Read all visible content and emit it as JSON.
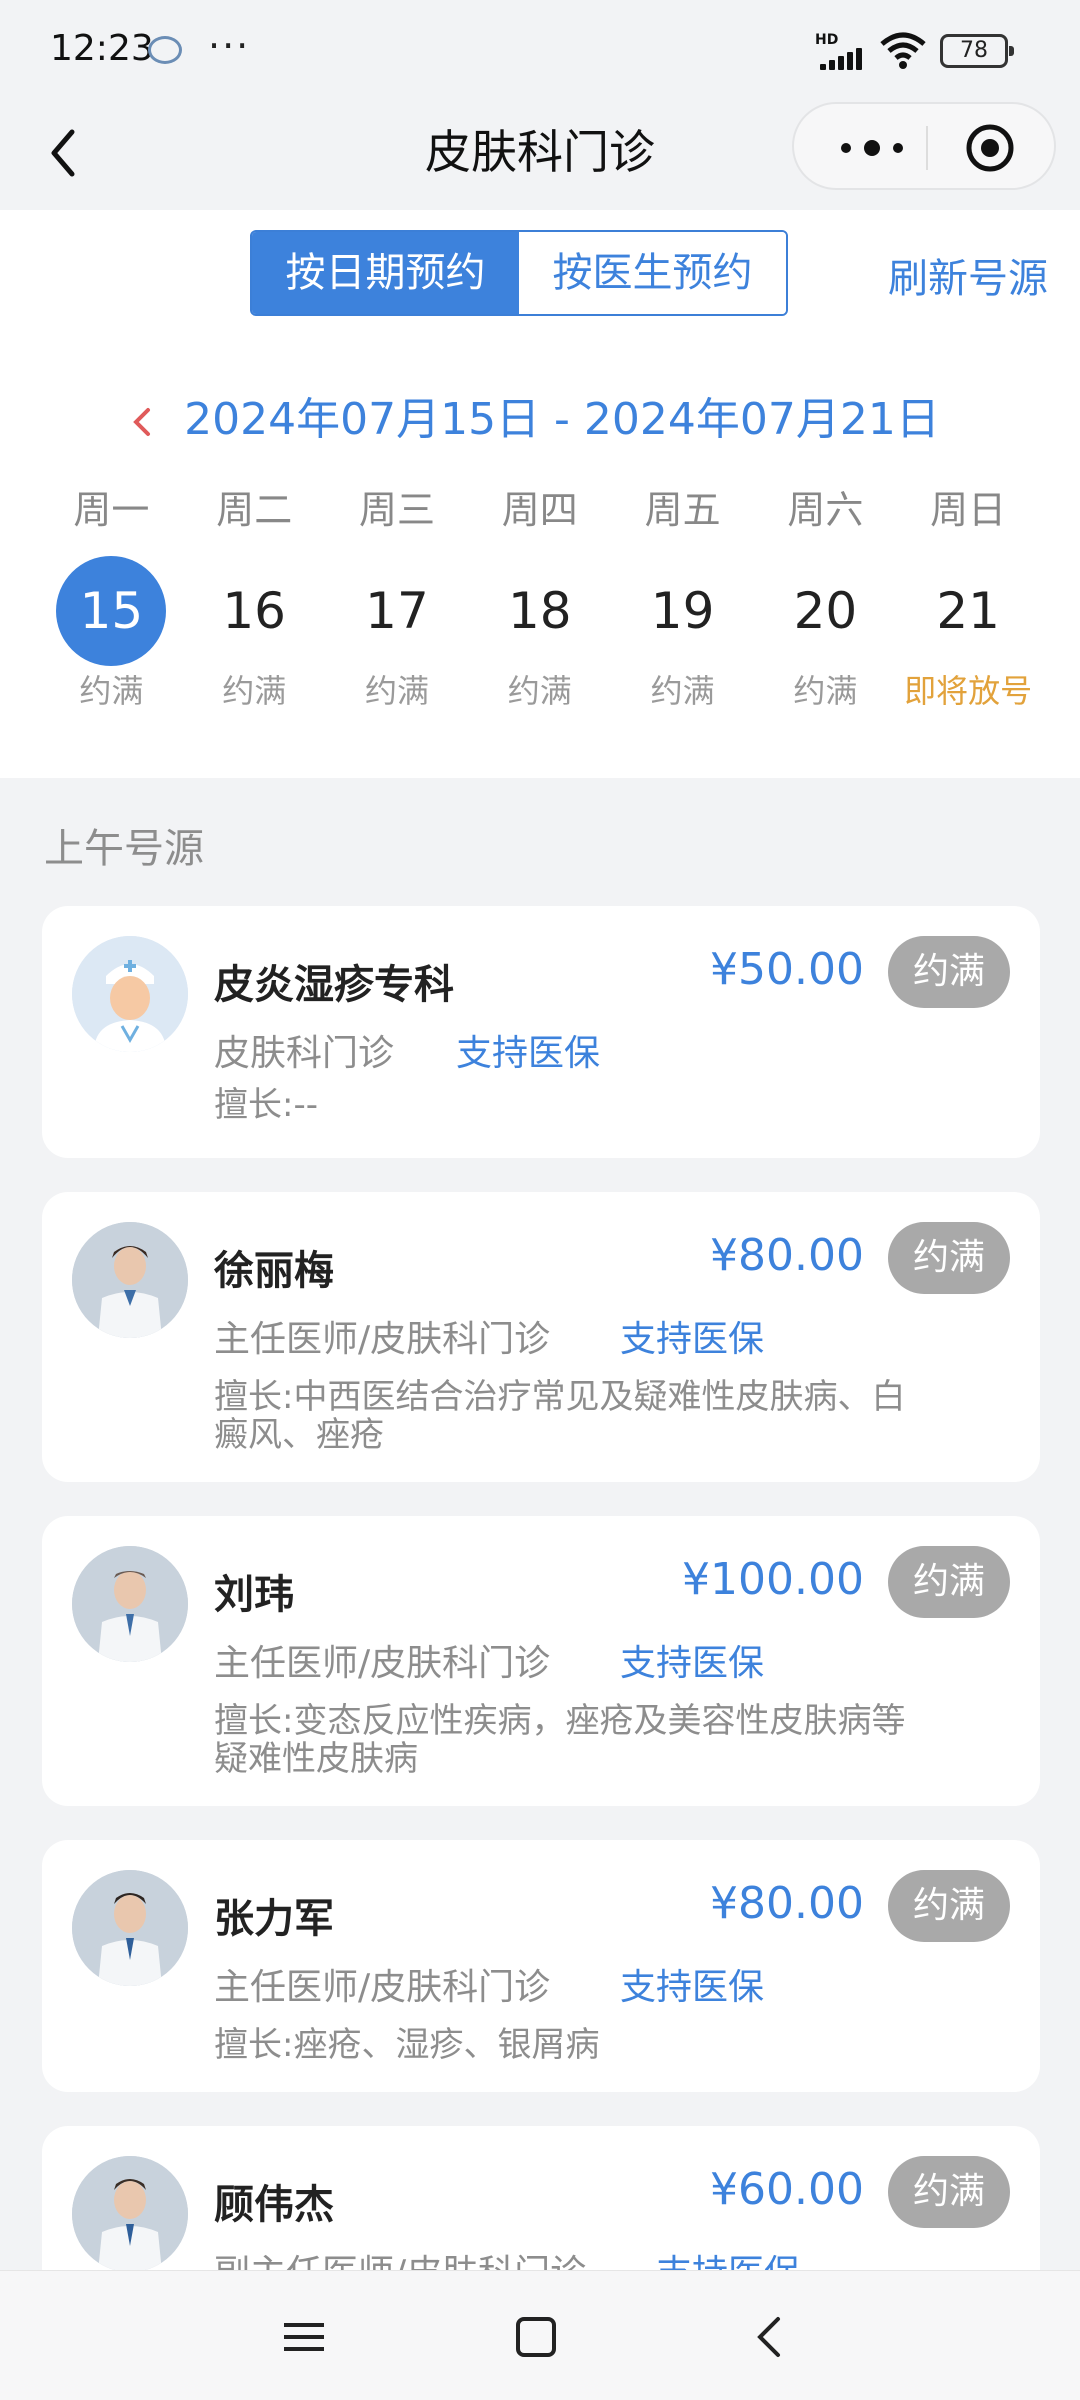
{
  "status_bar": {
    "time": "12:23",
    "dots": "···",
    "network_label": "HD",
    "battery": "78"
  },
  "nav": {
    "title": "皮肤科门诊",
    "back_icon": "chevron-left-icon",
    "more_icon": "more-dots-icon",
    "target_icon": "target-icon"
  },
  "tabs": {
    "by_date": "按日期预约",
    "by_doctor": "按医生预约",
    "active": "by_date"
  },
  "refresh_label": "刷新号源",
  "week": {
    "range": "2024年07月15日 - 2024年07月21日",
    "days": [
      {
        "weekday": "周一",
        "date": "15",
        "status": "约满",
        "selected": true
      },
      {
        "weekday": "周二",
        "date": "16",
        "status": "约满"
      },
      {
        "weekday": "周三",
        "date": "17",
        "status": "约满"
      },
      {
        "weekday": "周四",
        "date": "18",
        "status": "约满"
      },
      {
        "weekday": "周五",
        "date": "19",
        "status": "约满"
      },
      {
        "weekday": "周六",
        "date": "20",
        "status": "约满"
      },
      {
        "weekday": "周日",
        "date": "21",
        "status": "即将放号"
      }
    ]
  },
  "section_title": "上午号源",
  "doctors": [
    {
      "name": "皮炎湿疹专科",
      "price": "¥50.00",
      "status": "约满",
      "dept": "皮肤科门诊",
      "insurance": "支持医保",
      "skill": "擅长:--"
    },
    {
      "name": "徐丽梅",
      "price": "¥80.00",
      "status": "约满",
      "dept": "主任医师/皮肤科门诊",
      "insurance": "支持医保",
      "skill": "擅长:中西医结合治疗常见及疑难性皮肤病、白癜风、痤疮"
    },
    {
      "name": "刘玮",
      "price": "¥100.00",
      "status": "约满",
      "dept": "主任医师/皮肤科门诊",
      "insurance": "支持医保",
      "skill": "擅长:变态反应性疾病，痤疮及美容性皮肤病等疑难性皮肤病"
    },
    {
      "name": "张力军",
      "price": "¥80.00",
      "status": "约满",
      "dept": "主任医师/皮肤科门诊",
      "insurance": "支持医保",
      "skill": "擅长:痤疮、湿疹、银屑病"
    },
    {
      "name": "顾伟杰",
      "price": "¥60.00",
      "status": "约满",
      "dept": "副主任医师/皮肤科门诊",
      "insurance": "支持医保",
      "skill": ""
    }
  ],
  "system_nav": {
    "menu_icon": "menu-icon",
    "home_icon": "home-square-icon",
    "back_icon": "back-triangle-icon"
  },
  "colors": {
    "accent": "#3d82dc",
    "badge_gray": "#a9a9a9",
    "soon_orange": "#e2a23b"
  }
}
